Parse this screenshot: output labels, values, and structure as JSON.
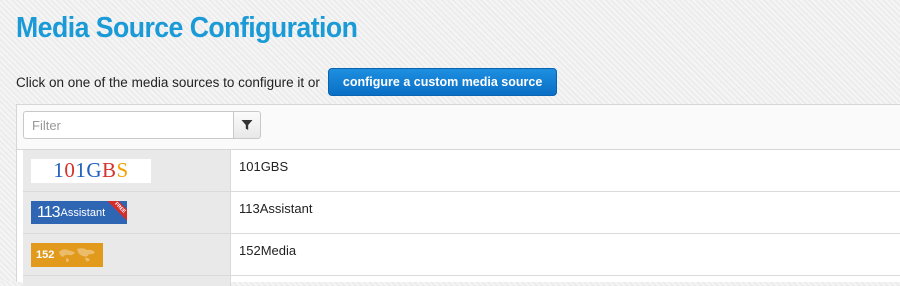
{
  "page": {
    "title": "Media Source Configuration",
    "intro_text": "Click on one of the media sources to configure it or",
    "custom_button_label": "configure a custom media source"
  },
  "filter": {
    "placeholder": "Filter",
    "value": "",
    "icon": "filter-icon"
  },
  "sources": [
    {
      "name": "101GBS",
      "logo": {
        "letters": [
          "1",
          "0",
          "1",
          "G",
          "B",
          "S"
        ],
        "colors": [
          "#1f5fbf",
          "#d6312b",
          "#1f5fbf",
          "#1f5fbf",
          "#d6312b",
          "#f2a100"
        ]
      }
    },
    {
      "name": "113Assistant",
      "logo": {
        "mark": "113",
        "text": "Assistant",
        "ribbon": "FREE"
      }
    },
    {
      "name": "152Media",
      "logo": {
        "mark": "152"
      }
    }
  ],
  "colors": {
    "title": "#1a9ad6",
    "button": "#0a6fc6"
  }
}
